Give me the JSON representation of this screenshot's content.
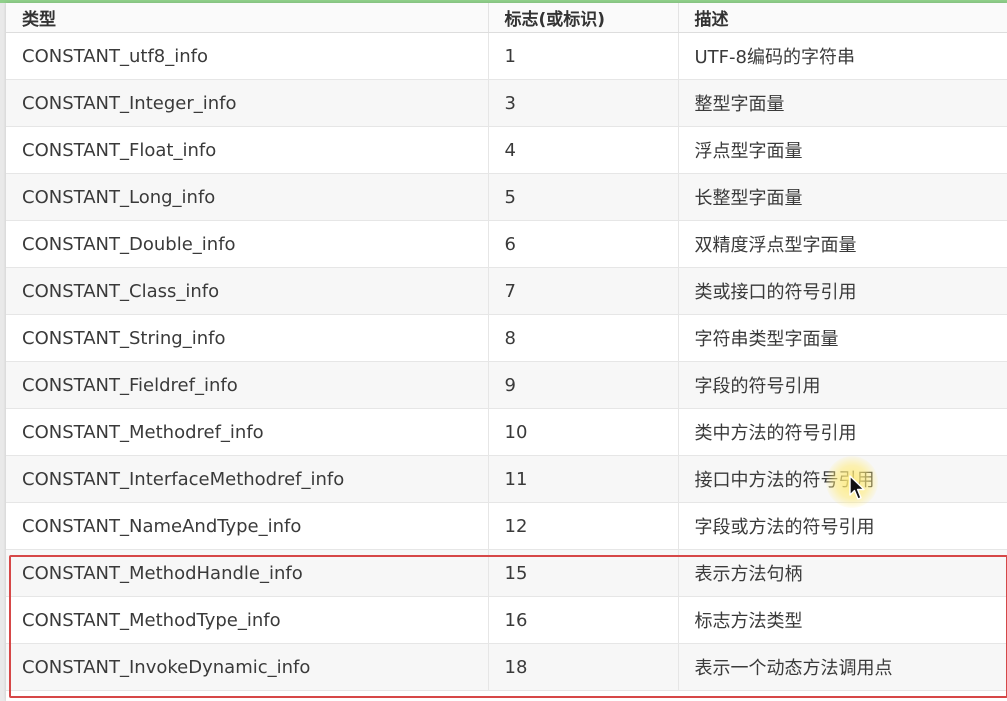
{
  "table": {
    "headers": [
      "类型",
      "标志(或标识)",
      "描述"
    ],
    "rows": [
      {
        "type": "CONSTANT_utf8_info",
        "tag": "1",
        "desc": "UTF-8编码的字符串"
      },
      {
        "type": "CONSTANT_Integer_info",
        "tag": "3",
        "desc": "整型字面量"
      },
      {
        "type": "CONSTANT_Float_info",
        "tag": "4",
        "desc": "浮点型字面量"
      },
      {
        "type": "CONSTANT_Long_info",
        "tag": "5",
        "desc": "长整型字面量"
      },
      {
        "type": "CONSTANT_Double_info",
        "tag": "6",
        "desc": "双精度浮点型字面量"
      },
      {
        "type": "CONSTANT_Class_info",
        "tag": "7",
        "desc": "类或接口的符号引用"
      },
      {
        "type": "CONSTANT_String_info",
        "tag": "8",
        "desc": "字符串类型字面量"
      },
      {
        "type": "CONSTANT_Fieldref_info",
        "tag": "9",
        "desc": "字段的符号引用"
      },
      {
        "type": "CONSTANT_Methodref_info",
        "tag": "10",
        "desc": "类中方法的符号引用"
      },
      {
        "type": "CONSTANT_InterfaceMethodref_info",
        "tag": "11",
        "desc": "接口中方法的符号引用"
      },
      {
        "type": "CONSTANT_NameAndType_info",
        "tag": "12",
        "desc": "字段或方法的符号引用"
      },
      {
        "type": "CONSTANT_MethodHandle_info",
        "tag": "15",
        "desc": "表示方法句柄"
      },
      {
        "type": "CONSTANT_MethodType_info",
        "tag": "16",
        "desc": "标志方法类型"
      },
      {
        "type": "CONSTANT_InvokeDynamic_info",
        "tag": "18",
        "desc": "表示一个动态方法调用点"
      }
    ]
  },
  "colors": {
    "highlight_border": "#d64747",
    "top_accent": "#8fcf8a",
    "cursor_glow": "#ffeb78"
  },
  "icons": {
    "cursor": "mouse-pointer-icon"
  }
}
